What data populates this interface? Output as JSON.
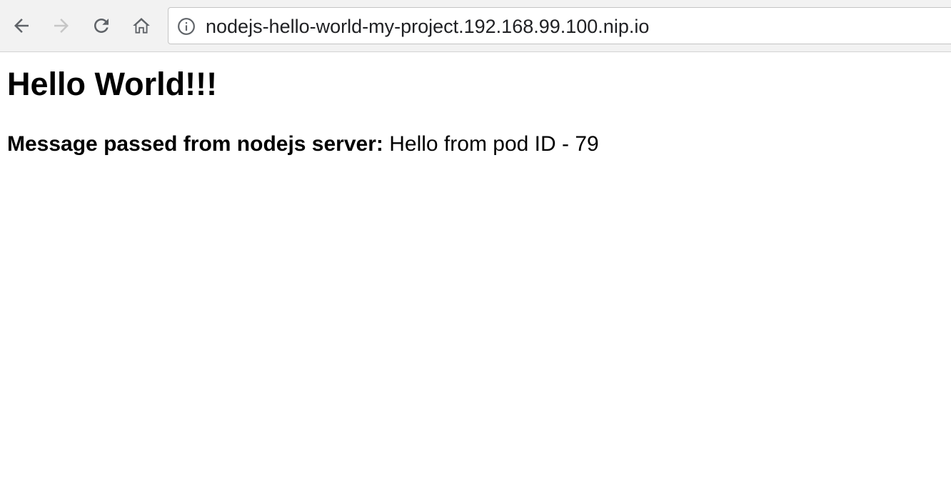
{
  "browser": {
    "url": "nodejs-hello-world-my-project.192.168.99.100.nip.io",
    "icons": {
      "back": "arrow-left-icon",
      "forward": "arrow-right-icon",
      "reload": "reload-icon",
      "home": "home-icon",
      "site_info": "info-circle-icon"
    },
    "forward_enabled": false
  },
  "page": {
    "heading": "Hello World!!!",
    "message_label": "Message passed from nodejs server:",
    "message_value": "Hello from pod ID - 79"
  },
  "colors": {
    "toolbar_bg": "#f2f2f2",
    "icon_active": "#5f6368",
    "icon_disabled": "#c6c6c6",
    "text": "#000000"
  }
}
